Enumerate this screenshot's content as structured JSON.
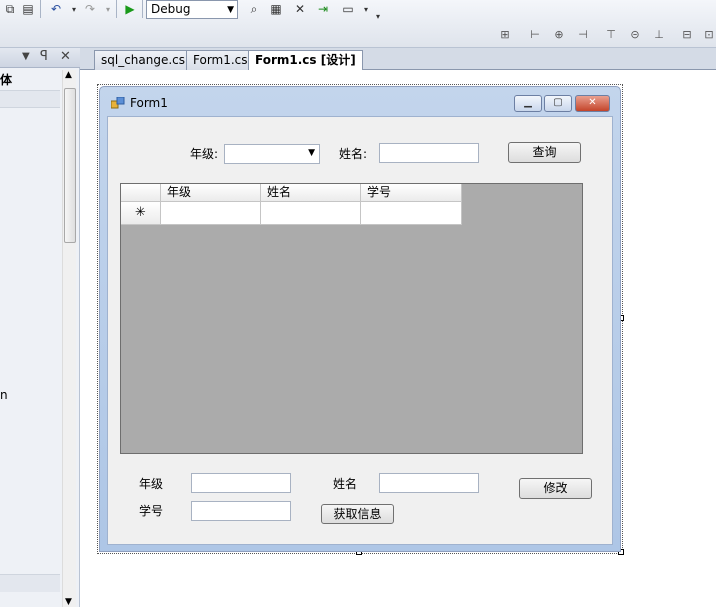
{
  "toolbar": {
    "config": "Debug",
    "undo_icon": "undo-icon",
    "redo_icon": "redo-icon",
    "start_icon": "play-icon"
  },
  "tabs": [
    {
      "label": "sql_change.cs",
      "active": false
    },
    {
      "label": "Form1.cs",
      "active": false
    },
    {
      "label": "Form1.cs [设计]",
      "active": true
    }
  ],
  "left_panel": {
    "title": "体",
    "pin_icon": "pin-icon",
    "close_icon": "close-icon",
    "stray_letter": "n"
  },
  "form": {
    "title": "Form1",
    "search_grade_label": "年级:",
    "search_name_label": "姓名:",
    "query_button": "查询",
    "grid": {
      "columns": [
        "年级",
        "姓名",
        "学号"
      ],
      "new_row_marker": "✳"
    },
    "bottom": {
      "grade_label": "年级",
      "name_label": "姓名",
      "id_label": "学号",
      "modify_button": "修改",
      "fetch_button": "获取信息"
    }
  },
  "colors": {
    "grid_background": "#ababab",
    "form_background": "#f0f0f0",
    "caption_blue": "#c3d5ec"
  }
}
